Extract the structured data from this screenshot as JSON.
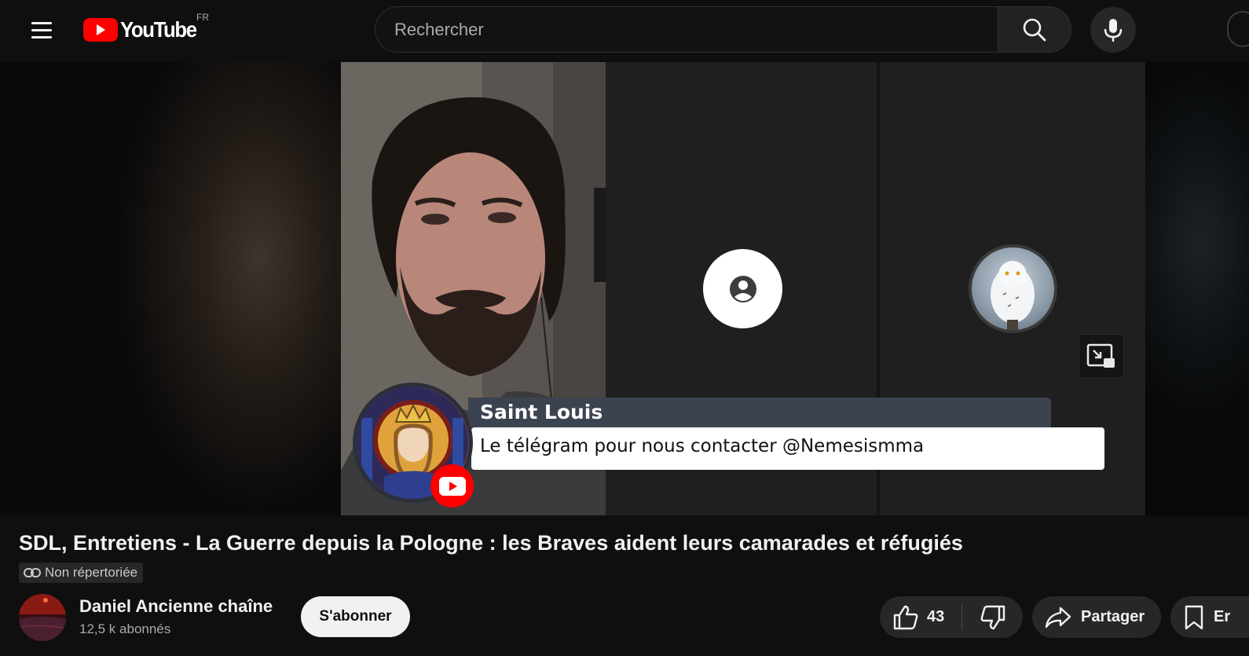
{
  "header": {
    "logo_text": "YouTube",
    "country_code": "FR",
    "search_placeholder": "Rechercher",
    "icons": {
      "menu": "hamburger-menu-icon",
      "search": "search-icon",
      "mic": "microphone-icon"
    }
  },
  "player": {
    "lower_third": {
      "name": "Saint Louis",
      "message": "Le télégram pour nous contacter @Nemesismma"
    }
  },
  "video": {
    "title": "SDL, Entretiens - La Guerre depuis la Pologne : les Braves aident leurs camarades et réfugiés",
    "visibility_label": "Non répertoriée"
  },
  "channel": {
    "name": "Daniel Ancienne chaîne",
    "subscribers": "12,5 k abonnés",
    "subscribe_label": "S'abonner"
  },
  "actions": {
    "like_count": "43",
    "share_label": "Partager",
    "save_label_partial": "Er"
  },
  "colors": {
    "background": "#0f0f0f",
    "brand_red": "#ff0000",
    "chip_bg": "#272727",
    "lower_third_bar": "#3c4350"
  }
}
